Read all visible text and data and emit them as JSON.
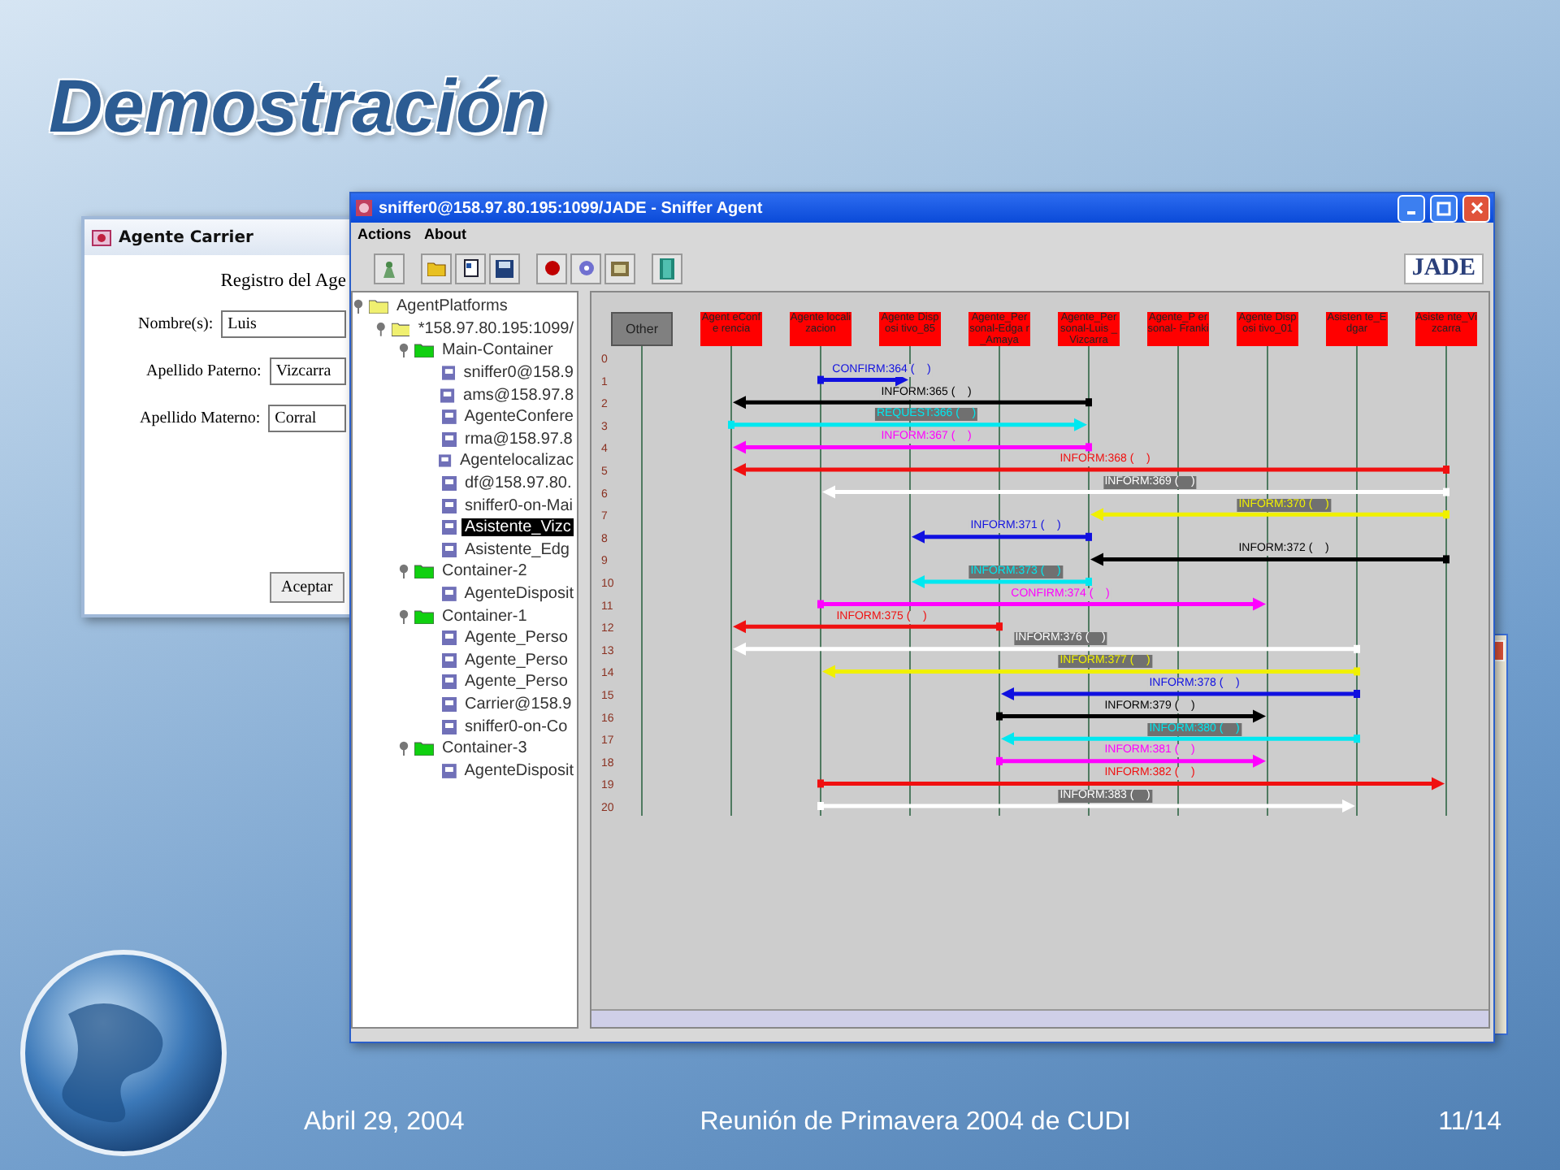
{
  "slide": {
    "title": "Demostración",
    "footer": {
      "date": "Abril 29, 2004",
      "event": "Reunión de Primavera 2004 de CUDI",
      "page": "11/14"
    }
  },
  "carrier_window": {
    "title": "Agente Carrier",
    "heading": "Registro del Age",
    "fields": [
      {
        "label": "Nombre(s):",
        "value": "Luis"
      },
      {
        "label": "Apellido Paterno:",
        "value": "Vizcarra"
      },
      {
        "label": "Apellido Materno:",
        "value": "Corral"
      }
    ],
    "button": "Aceptar"
  },
  "sniffer_window": {
    "title": "sniffer0@158.97.80.195:1099/JADE - Sniffer Agent",
    "menu": [
      "Actions",
      "About"
    ],
    "logo": "JADE",
    "tree": [
      {
        "kind": "platform",
        "label": "AgentPlatforms",
        "selected": false,
        "children": [
          {
            "kind": "platform",
            "label": "*158.97.80.195:1099/",
            "selected": false,
            "children": [
              {
                "kind": "container",
                "label": "Main-Container",
                "selected": false,
                "children": [
                  {
                    "kind": "agent",
                    "label": "sniffer0@158.9",
                    "selected": false
                  },
                  {
                    "kind": "agent",
                    "label": "ams@158.97.8",
                    "selected": false
                  },
                  {
                    "kind": "agent",
                    "label": "AgenteConfere",
                    "selected": false
                  },
                  {
                    "kind": "agent",
                    "label": "rma@158.97.8",
                    "selected": false
                  },
                  {
                    "kind": "agent",
                    "label": "Agentelocalizac",
                    "selected": false
                  },
                  {
                    "kind": "agent",
                    "label": "df@158.97.80.",
                    "selected": false
                  },
                  {
                    "kind": "agent",
                    "label": "sniffer0-on-Mai",
                    "selected": false
                  },
                  {
                    "kind": "agent",
                    "label": "Asistente_Vizc",
                    "selected": true
                  },
                  {
                    "kind": "agent",
                    "label": "Asistente_Edg",
                    "selected": false
                  }
                ]
              },
              {
                "kind": "container",
                "label": "Container-2",
                "selected": false,
                "children": [
                  {
                    "kind": "agent",
                    "label": "AgenteDisposit",
                    "selected": false
                  }
                ]
              },
              {
                "kind": "container",
                "label": "Container-1",
                "selected": false,
                "children": [
                  {
                    "kind": "agent",
                    "label": "Agente_Perso",
                    "selected": false
                  },
                  {
                    "kind": "agent",
                    "label": "Agente_Perso",
                    "selected": false
                  },
                  {
                    "kind": "agent",
                    "label": "Agente_Perso",
                    "selected": false
                  },
                  {
                    "kind": "agent",
                    "label": "Carrier@158.9",
                    "selected": false
                  },
                  {
                    "kind": "agent",
                    "label": "sniffer0-on-Co",
                    "selected": false
                  }
                ]
              },
              {
                "kind": "container",
                "label": "Container-3",
                "selected": false,
                "children": [
                  {
                    "kind": "agent",
                    "label": "AgenteDisposit",
                    "selected": false
                  }
                ]
              }
            ]
          }
        ]
      }
    ],
    "agents": [
      {
        "kind": "other",
        "label": "Other"
      },
      {
        "kind": "agent",
        "label": "Agent eConfe rencia"
      },
      {
        "kind": "agent",
        "label": "Agente locali zacion"
      },
      {
        "kind": "agent",
        "label": "Agente Disposi tivo_85"
      },
      {
        "kind": "agent",
        "label": "Agente_Per sonal-Edga r_Amaya"
      },
      {
        "kind": "agent",
        "label": "Agente_Per sonal-Luis _Vizcarra"
      },
      {
        "kind": "agent",
        "label": "Agente_P ersonal- Franki"
      },
      {
        "kind": "agent",
        "label": "Agente Disposi tivo_01"
      },
      {
        "kind": "agent",
        "label": "Asisten te_Edgar"
      },
      {
        "kind": "agent",
        "label": "Asiste nte_Vi zcarra"
      }
    ],
    "rows": [
      {
        "number": "0"
      },
      {
        "number": "1",
        "message": {
          "label": "CONFIRM:364 (    )",
          "color": "#1010e0"
        }
      },
      {
        "number": "2",
        "message": {
          "label": "INFORM:365 (    )",
          "color": "#000000"
        }
      },
      {
        "number": "3",
        "message": {
          "label": "REQUEST:366 (    )",
          "color": "#00e8f0"
        }
      },
      {
        "number": "4",
        "message": {
          "label": "INFORM:367 (    )",
          "color": "#ff00ff"
        }
      },
      {
        "number": "5",
        "message": {
          "label": "INFORM:368 (    )",
          "color": "#f01010"
        }
      },
      {
        "number": "6",
        "message": {
          "label": "INFORM:369 (    )",
          "color": "#ffffff"
        }
      },
      {
        "number": "7",
        "message": {
          "label": "INFORM:370 (    )",
          "color": "#f0f000"
        }
      },
      {
        "number": "8",
        "message": {
          "label": "INFORM:371 (    )",
          "color": "#1010e0"
        }
      },
      {
        "number": "9",
        "message": {
          "label": "INFORM:372 (    )",
          "color": "#000000"
        }
      },
      {
        "number": "10",
        "message": {
          "label": "INFORM:373 (    )",
          "color": "#00e8f0"
        }
      },
      {
        "number": "11",
        "message": {
          "label": "CONFIRM:374 (    )",
          "color": "#ff00ff"
        }
      },
      {
        "number": "12",
        "message": {
          "label": "INFORM:375 (    )",
          "color": "#f01010"
        }
      },
      {
        "number": "13",
        "message": {
          "label": "INFORM:376 (    )",
          "color": "#ffffff"
        }
      },
      {
        "number": "14",
        "message": {
          "label": "INFORM:377 (    )",
          "color": "#f0f000"
        }
      },
      {
        "number": "15",
        "message": {
          "label": "INFORM:378 (    )",
          "color": "#1010e0"
        }
      },
      {
        "number": "16",
        "message": {
          "label": "INFORM:379 (    )",
          "color": "#000000"
        }
      },
      {
        "number": "17",
        "message": {
          "label": "INFORM:380 (    )",
          "color": "#00e8f0"
        }
      },
      {
        "number": "18",
        "message": {
          "label": "INFORM:381 (    )",
          "color": "#ff00ff"
        }
      },
      {
        "number": "19",
        "message": {
          "label": "INFORM:382 (    )",
          "color": "#f01010"
        }
      },
      {
        "number": "20",
        "message": {
          "label": "INFORM:383 (    )",
          "color": "#ffffff"
        }
      }
    ]
  }
}
